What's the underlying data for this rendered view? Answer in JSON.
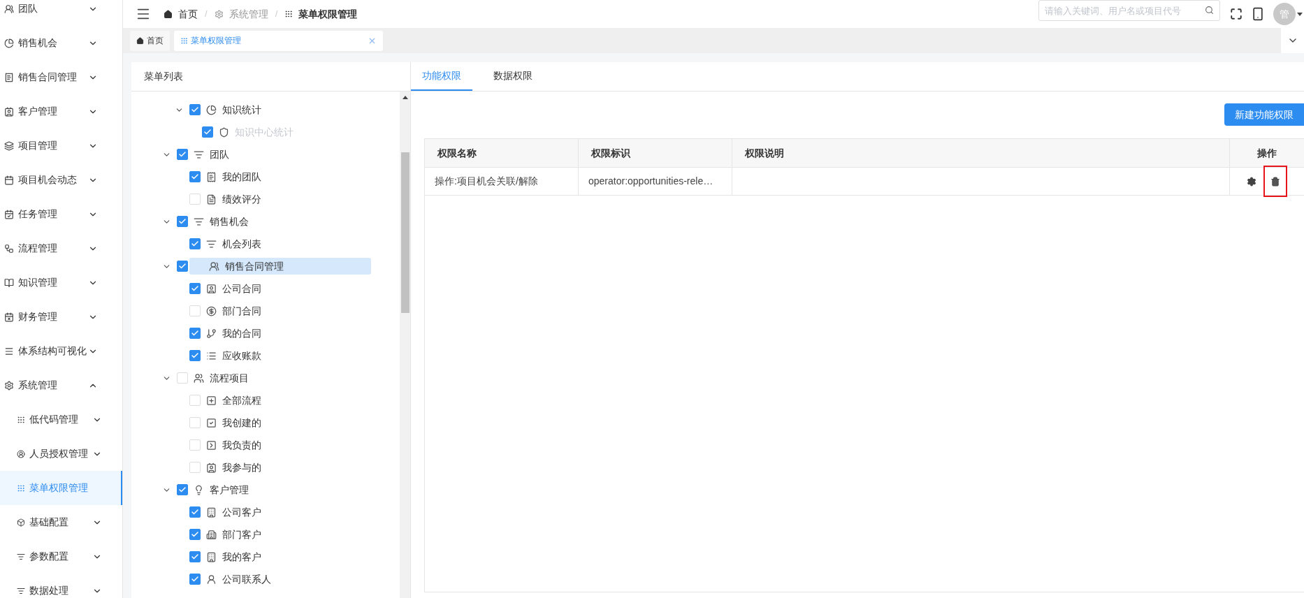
{
  "sidebar": {
    "items": [
      {
        "label": "团队",
        "expanded": false,
        "selected": false
      },
      {
        "label": "销售机会",
        "expanded": false,
        "selected": false
      },
      {
        "label": "销售合同管理",
        "expanded": false,
        "selected": false
      },
      {
        "label": "客户管理",
        "expanded": false,
        "selected": false
      },
      {
        "label": "项目管理",
        "expanded": false,
        "selected": false
      },
      {
        "label": "项目机会动态",
        "expanded": false,
        "selected": false
      },
      {
        "label": "任务管理",
        "expanded": false,
        "selected": false
      },
      {
        "label": "流程管理",
        "expanded": false,
        "selected": false
      },
      {
        "label": "知识管理",
        "expanded": false,
        "selected": false
      },
      {
        "label": "财务管理",
        "expanded": false,
        "selected": false
      },
      {
        "label": "体系结构可视化",
        "expanded": false,
        "selected": false
      },
      {
        "label": "系统管理",
        "expanded": true,
        "selected": false,
        "children": [
          {
            "label": "低代码管理",
            "expanded": false,
            "selected": false
          },
          {
            "label": "人员授权管理",
            "expanded": false,
            "selected": false
          },
          {
            "label": "菜单权限管理",
            "selected": true
          },
          {
            "label": "基础配置",
            "expanded": false,
            "selected": false
          },
          {
            "label": "参数配置",
            "expanded": false,
            "selected": false
          },
          {
            "label": "数据处理",
            "expanded": false,
            "selected": false
          }
        ]
      }
    ]
  },
  "breadcrumb": [
    {
      "label": "首页",
      "current": false
    },
    {
      "separator": "/",
      "label": "系统管理",
      "current": false
    },
    {
      "separator": "/",
      "label": "菜单权限管理",
      "current": true
    }
  ],
  "search": {
    "placeholder": "请输入关键词、用户名或项目代号"
  },
  "avatar": "管",
  "page_tabs": [
    {
      "label": "首页",
      "selected": false,
      "closable": false
    },
    {
      "label": "菜单权限管理",
      "selected": true,
      "closable": true
    }
  ],
  "menu_tree": {
    "title": "菜单列表",
    "items": [
      {
        "children": [
          {
            "label": "知识统计",
            "checked": true,
            "expanded": true,
            "selected": false,
            "disabled": false,
            "children": [
              {
                "label": "知识中心统计",
                "checked": true,
                "selected": false,
                "disabled": true
              }
            ]
          }
        ]
      },
      {
        "label": "团队",
        "checked": true,
        "expanded": true,
        "selected": false,
        "disabled": false,
        "children": [
          {
            "label": "我的团队",
            "checked": true,
            "selected": false,
            "disabled": false
          },
          {
            "label": "绩效评分",
            "checked": false,
            "selected": false,
            "disabled": false
          }
        ]
      },
      {
        "label": "销售机会",
        "checked": true,
        "expanded": true,
        "selected": false,
        "disabled": false,
        "children": [
          {
            "label": "机会列表",
            "checked": true,
            "selected": false,
            "disabled": false
          }
        ]
      },
      {
        "label": "销售合同管理",
        "checked": true,
        "expanded": true,
        "selected": true,
        "disabled": false,
        "children": [
          {
            "label": "公司合同",
            "checked": true,
            "selected": false,
            "disabled": false
          },
          {
            "label": "部门合同",
            "checked": false,
            "selected": false,
            "disabled": false
          },
          {
            "label": "我的合同",
            "checked": true,
            "selected": false,
            "disabled": false
          },
          {
            "label": "应收账款",
            "checked": true,
            "selected": false,
            "disabled": false
          }
        ]
      },
      {
        "label": "流程项目",
        "checked": false,
        "expanded": true,
        "selected": false,
        "disabled": false,
        "children": [
          {
            "label": "全部流程",
            "checked": false,
            "selected": false,
            "disabled": false
          },
          {
            "label": "我创建的",
            "checked": false,
            "selected": false,
            "disabled": false
          },
          {
            "label": "我负责的",
            "checked": false,
            "selected": false,
            "disabled": false
          },
          {
            "label": "我参与的",
            "checked": false,
            "selected": false,
            "disabled": false
          }
        ]
      },
      {
        "label": "客户管理",
        "checked": true,
        "expanded": true,
        "selected": false,
        "disabled": false,
        "children": [
          {
            "label": "公司客户",
            "checked": true,
            "selected": false,
            "disabled": false
          },
          {
            "label": "部门客户",
            "checked": true,
            "selected": false,
            "disabled": false
          },
          {
            "label": "我的客户",
            "checked": true,
            "selected": false,
            "disabled": false
          },
          {
            "label": "公司联系人",
            "checked": true,
            "selected": false,
            "disabled": false
          }
        ]
      }
    ]
  },
  "permission_tabs": [
    {
      "label": "功能权限",
      "selected": true
    },
    {
      "label": "数据权限",
      "selected": false
    }
  ],
  "new_button": "新建功能权限",
  "table": {
    "columns": [
      "权限名称",
      "权限标识",
      "权限说明",
      "操作"
    ],
    "rows": [
      {
        "cells": [
          "操作:项目机会关联/解除",
          "operator:opportunities-rele…",
          ""
        ],
        "delete_highlighted": true
      }
    ]
  }
}
